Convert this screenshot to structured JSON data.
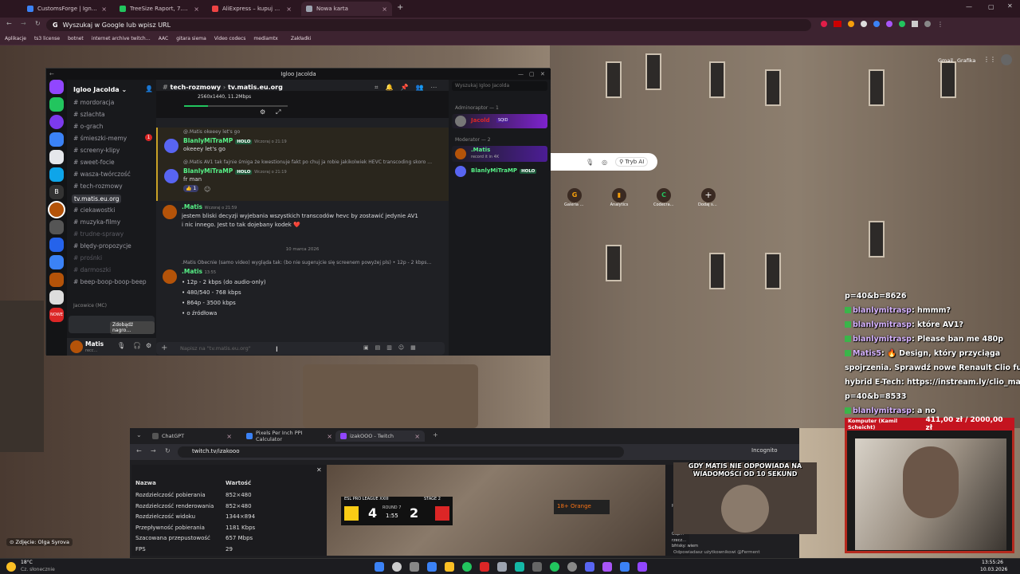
{
  "browser": {
    "tabs": [
      {
        "label": "CustomsForge | Ignition4",
        "color": "#3b82f6"
      },
      {
        "label": "TreeSize Raport, 7.02.2026 23:…",
        "color": "#22c55e"
      },
      {
        "label": "AliExpress – kupuj online produ…",
        "color": "#ef4444"
      },
      {
        "label": "Nowa karta",
        "color": "#9ca3af"
      }
    ],
    "omnibox": "Wyszukaj w Google lub wpisz URL",
    "bookmarks": [
      "Aplikacje",
      "ts3 license",
      "botnet",
      "internet archive twitch…",
      "AAC",
      "gitara siema",
      "Video codecs",
      "mediamtx",
      "Zakładki"
    ],
    "google_links": {
      "gmail": "Gmail",
      "images": "Grafika"
    },
    "ai_mode": "Tryb AI",
    "shortcut_labels": [
      "Galeria zdjęć",
      "Analytics",
      "Codecrafters",
      "Dodaj skrót"
    ]
  },
  "discord": {
    "window_title": "Igloo Jacolda",
    "server_name": "Igloo Jacolda",
    "channels": [
      {
        "name": "mordoracja",
        "state": "normal"
      },
      {
        "name": "szlachta",
        "state": "normal"
      },
      {
        "name": "o-grach",
        "state": "normal"
      },
      {
        "name": "śmieszki-memy",
        "state": "normal"
      },
      {
        "name": "screeny-klipy",
        "state": "normal"
      },
      {
        "name": "sweet-focie",
        "state": "normal"
      },
      {
        "name": "wasza-twórczość",
        "state": "normal"
      },
      {
        "name": "tech-rozmowy",
        "state": "normal"
      },
      {
        "name": "tv.matis.eu.org",
        "state": "selected"
      },
      {
        "name": "ciekawostki",
        "state": "normal"
      },
      {
        "name": "muzyka-filmy",
        "state": "normal"
      },
      {
        "name": "trudne-sprawy",
        "state": "dim"
      },
      {
        "name": "błędy-propozycje",
        "state": "normal"
      },
      {
        "name": "prośnki",
        "state": "dim"
      },
      {
        "name": "darmoszki",
        "state": "dim"
      },
      {
        "name": "beep-boop-boop-beep",
        "state": "normal"
      }
    ],
    "category": "Jacowice (MC)",
    "quest": "Zdobądź nagro…",
    "notification_badge": "1",
    "user": {
      "name": "Matis",
      "status": "recc…"
    },
    "breadcrumb": {
      "parent": "tech-rozmowy",
      "thread": "tv.matis.eu.org"
    },
    "search_placeholder": "Wyszukaj Igloo Jacolda",
    "video_info": "2560x1440, 11.2Mbps",
    "messages": [
      {
        "reply": "@.Matis okeeey let's go",
        "user": "BlanlyMiTraMP",
        "tag": "HOLO",
        "time": "Wczoraj o 21:19",
        "text": "okeeey let's go"
      },
      {
        "reply": "@.Matis AV1 tak fajnie śmiga że kwestionuje fakt po chuj ja robie jakikolwiek HEVC transcoding skoro …",
        "user": "BlanlyMiTraMP",
        "tag": "HOLO",
        "time": "Wczoraj o 21:19",
        "text": "fr man",
        "reaction": "1"
      },
      {
        "user": ".Matis",
        "time": "Wczoraj o 21:59",
        "text": "jestem bliski decyzji wyjebania wszystkich transcodów hevc by zostawić jedynie AV1 i nic innego. Jest to tak dojebany kodek ❤️"
      },
      {
        "divider": "10 marca 2026"
      },
      {
        "reply": ".Matis Obecnie (samo video) wygląda tak: (bo nie sugerujcie się screenem powyżej pls) • 12p - 2 kbps…",
        "user": ".Matis",
        "time": "13:55",
        "bullets": [
          "12p - 2 kbps (do audio-only)",
          "480/540 - 768 kbps",
          "864p - 3500 kbps",
          "o  źródłowa"
        ]
      }
    ],
    "input_placeholder": "Napisz na \"tv.matis.eu.org\"",
    "members": {
      "admin_header": "Adminoraptor — 1",
      "admin": {
        "name": "Jacold",
        "tag": "SQID"
      },
      "mod_header": "Moderator — 2",
      "mods": [
        {
          "name": ".Matis",
          "status": "record it in 4K"
        },
        {
          "name": "BlanlyMiTraMP",
          "tag": "HOLO"
        }
      ]
    }
  },
  "chat_overlay": [
    {
      "user": "",
      "text": "p=40&b=8626"
    },
    {
      "user": "blanlymitrasp",
      "text": ": hmmm?"
    },
    {
      "user": "blanlymitrasp",
      "text": ": które AV1?"
    },
    {
      "user": "blanlymitrasp",
      "text": ": Please ban me 480p"
    },
    {
      "user": "Matis5",
      "text": ": 🔥 Design, który przyciąga"
    },
    {
      "user": "",
      "text": "spojrzenia. Sprawdź nowe Renault Clio full"
    },
    {
      "user": "",
      "text": "hybrid E-Tech: https://instream.ly/clio_matis5?"
    },
    {
      "user": "",
      "text": "p=40&b=8533"
    },
    {
      "user": "blanlymitrasp",
      "text": ": a no"
    }
  ],
  "donation_bar": {
    "label": "Komputer (Kamil Scheicht)",
    "current": "411,00 zł",
    "goal": "2000,00 zł"
  },
  "webcam_caption": "GDY MATIS NIE ODPOWIADA NA WIADOMOŚCI OD 10 SEKUND",
  "browser2": {
    "tabs": [
      "ChatGPT",
      "Pixels Per Inch PPI Calculator",
      "izakOOO - Twitch"
    ],
    "url": "twitch.tv/izakooo",
    "incognito": "Incognito",
    "stats_header": {
      "name": "Nazwa",
      "value": "Wartość"
    },
    "stats": [
      {
        "name": "Rozdzielczość pobierania",
        "value": "852×480"
      },
      {
        "name": "Rozdzielczość renderowania",
        "value": "852×480"
      },
      {
        "name": "Rozdzielczość widoku",
        "value": "1344×894"
      },
      {
        "name": "Przepływność pobierania",
        "value": "1181 Kbps"
      },
      {
        "name": "Szacowana przepustowość",
        "value": "657 Mbps"
      },
      {
        "name": "FPS",
        "value": "29"
      }
    ],
    "scoreboard": {
      "league": "ESL PRO LEAGUE XXIII",
      "stage": "STAGE 2",
      "left": "4",
      "right": "2",
      "round": "ROUND 7",
      "clock": "1:55"
    },
    "ad": "Orange",
    "chat_lines": [
      "prustu",
      "Odp…",
      "rzecz…",
      "bfrisky: wiem",
      "Odpowiadasz użytkownikowi @Ferment"
    ]
  },
  "photo_credit": "Zdjęcie: Olga Syrova",
  "taskbar": {
    "weather_temp": "18°C",
    "weather_text": "Cz. słonecznie",
    "time": "13:55:26",
    "date": "10.03.2026"
  }
}
